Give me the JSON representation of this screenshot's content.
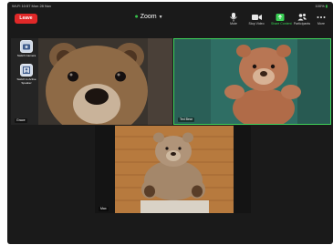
{
  "status_bar": {
    "left_text": "Wi-Fi 10:57 Mon 28 Nov",
    "right_text": "100%"
  },
  "top_bar": {
    "leave_label": "Leave",
    "title": "Zoom",
    "subtitle": ""
  },
  "toolbar": [
    {
      "label": "Mute",
      "icon": "microphone-icon",
      "active": false
    },
    {
      "label": "Stop Video",
      "icon": "video-camera-icon",
      "active": false
    },
    {
      "label": "Share Content",
      "icon": "share-screen-icon",
      "active": true
    },
    {
      "label": "Participants",
      "icon": "participants-icon",
      "active": false
    },
    {
      "label": "More",
      "icon": "more-icon",
      "active": false
    }
  ],
  "side_controls": [
    {
      "label": "Switch Camera",
      "icon": "switch-camera-icon"
    },
    {
      "label": "Switch to Active Speaker",
      "icon": "active-speaker-icon"
    }
  ],
  "participants": [
    {
      "name": "Grace",
      "highlighted": false
    },
    {
      "name": "Ted Bear",
      "highlighted": true
    },
    {
      "name": "Max",
      "highlighted": false
    }
  ],
  "colors": {
    "leave_button": "#e02828",
    "active_speaker_border": "#3fd25a",
    "active_tool": "#3ad155",
    "background": "#1a1a1a"
  }
}
